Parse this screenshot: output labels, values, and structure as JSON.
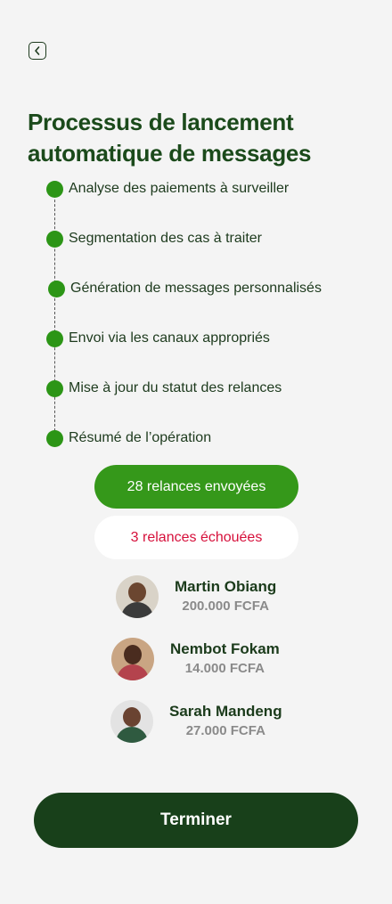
{
  "header": {
    "back_icon": "chevron-left-icon"
  },
  "title": "Processus de lancement automatique de messages",
  "steps": [
    {
      "label": "Analyse des paiements à surveiller"
    },
    {
      "label": "Segmentation des cas à traiter"
    },
    {
      "label": "Génération de messages personnalisés"
    },
    {
      "label": "Envoi via les canaux appropriés"
    },
    {
      "label": "Mise à jour du statut des relances"
    },
    {
      "label": "Résumé de l’opération"
    }
  ],
  "results": {
    "sent": "28 relances envoyées",
    "failed": "3 relances échouées"
  },
  "contacts": [
    {
      "name": "Martin Obiang",
      "amount": "200.000 FCFA"
    },
    {
      "name": "Nembot Fokam",
      "amount": "14.000 FCFA"
    },
    {
      "name": "Sarah Mandeng",
      "amount": "27.000 FCFA"
    }
  ],
  "footer": {
    "finish_label": "Terminer"
  },
  "colors": {
    "step_dot": "#2c9516",
    "sent_pill": "#35981a",
    "failed_text": "#d6103b",
    "primary_button": "#18401a"
  }
}
